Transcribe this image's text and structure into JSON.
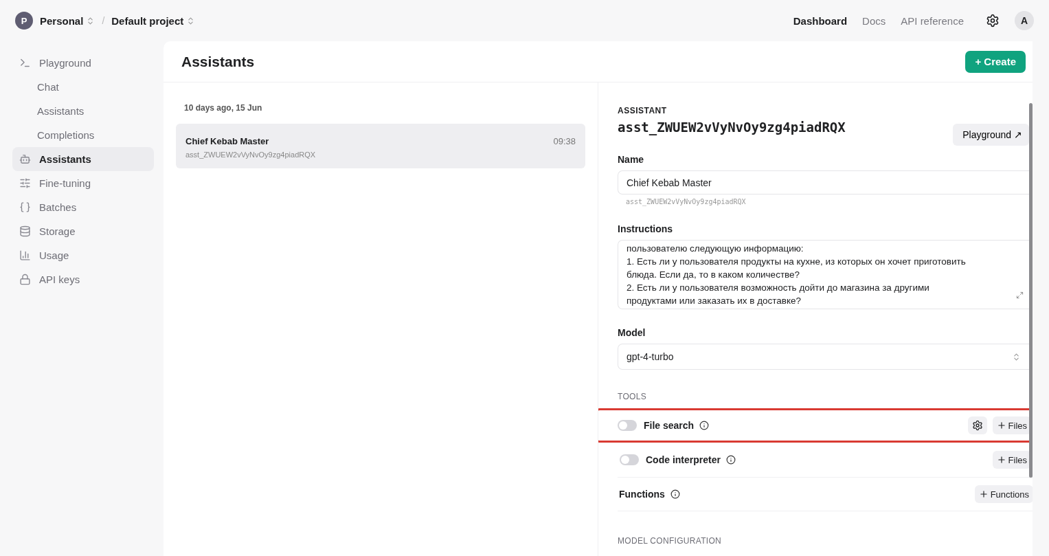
{
  "header": {
    "org_initial": "P",
    "org": "Personal",
    "separator": "/",
    "project": "Default project",
    "nav": [
      {
        "label": "Dashboard",
        "selected": true
      },
      {
        "label": "Docs",
        "selected": false
      },
      {
        "label": "API reference",
        "selected": false
      }
    ],
    "avatar": "A"
  },
  "sidebar": {
    "items": [
      {
        "label": "Playground",
        "selected": false,
        "children": [
          {
            "label": "Chat",
            "selected": false
          },
          {
            "label": "Assistants",
            "selected": false
          },
          {
            "label": "Completions",
            "selected": false
          }
        ]
      },
      {
        "label": "Assistants",
        "selected": true
      },
      {
        "label": "Fine-tuning",
        "selected": false
      },
      {
        "label": "Batches",
        "selected": false
      },
      {
        "label": "Storage",
        "selected": false
      },
      {
        "label": "Usage",
        "selected": false
      },
      {
        "label": "API keys",
        "selected": false
      }
    ]
  },
  "page": {
    "title": "Assistants",
    "create_button": "+ Create"
  },
  "list": {
    "group": "10 days ago, 15 Jun",
    "items": [
      {
        "name": "Chief Kebab Master",
        "id": "asst_ZWUEW2vVyNvOy9zg4piadRQX",
        "time": "09:38",
        "selected": true
      }
    ]
  },
  "detail": {
    "eyebrow": "ASSISTANT",
    "id": "asst_ZWUEW2vVyNvOy9zg4piadRQX",
    "playground_button": "Playground ↗",
    "name_label": "Name",
    "name_value": "Chief Kebab Master",
    "name_hint": "asst_ZWUEW2vVyNvOy9zg4piadRQX",
    "instructions_label": "Instructions",
    "instructions_lines": [
      "пользователю следующую информацию:",
      "1. Есть ли у пользователя продукты на кухне, из которых он хочет приготовить блюда. Если да, то в каком количестве?",
      "2. Есть ли у пользователя возможность дойти до магазина за другими продуктами или заказать их в доставке?"
    ],
    "model_label": "Model",
    "model_value": "gpt-4-turbo",
    "tools_heading": "TOOLS",
    "tools": [
      {
        "label": "File search",
        "on": false,
        "highlighted": true,
        "buttons": [
          {
            "kind": "settings"
          },
          {
            "kind": "add",
            "label": "Files"
          }
        ]
      },
      {
        "label": "Code interpreter",
        "on": false,
        "highlighted": false,
        "buttons": [
          {
            "kind": "add",
            "label": "Files"
          }
        ]
      }
    ],
    "functions_label": "Functions",
    "functions_button": "Functions",
    "config_heading": "MODEL CONFIGURATION"
  }
}
